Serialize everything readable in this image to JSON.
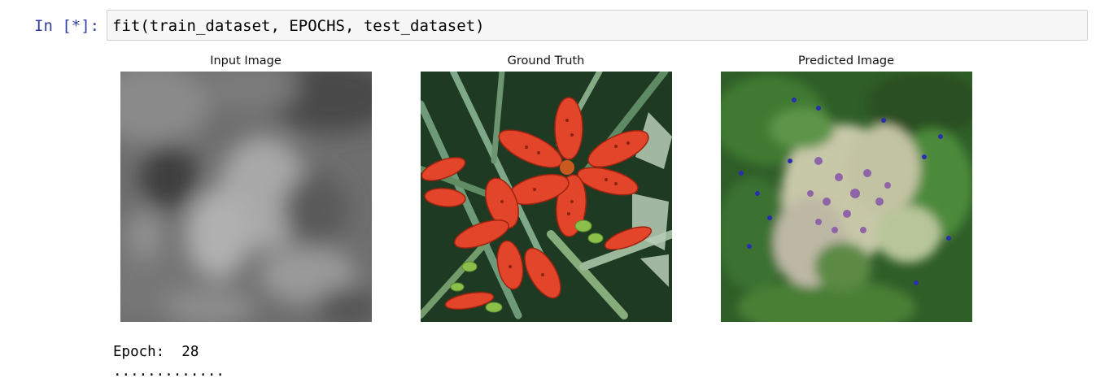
{
  "cell": {
    "prompt": "In [*]:",
    "code": "fit(train_dataset, EPOCHS, test_dataset)"
  },
  "figure": {
    "titles": [
      "Input Image",
      "Ground Truth",
      "Predicted Image"
    ]
  },
  "output": {
    "line1": "Epoch:  28",
    "line2": "............."
  },
  "colors": {
    "prompt": "#303f9f",
    "input_bg": "#f7f7f7",
    "input_border": "#cfcfcf"
  }
}
